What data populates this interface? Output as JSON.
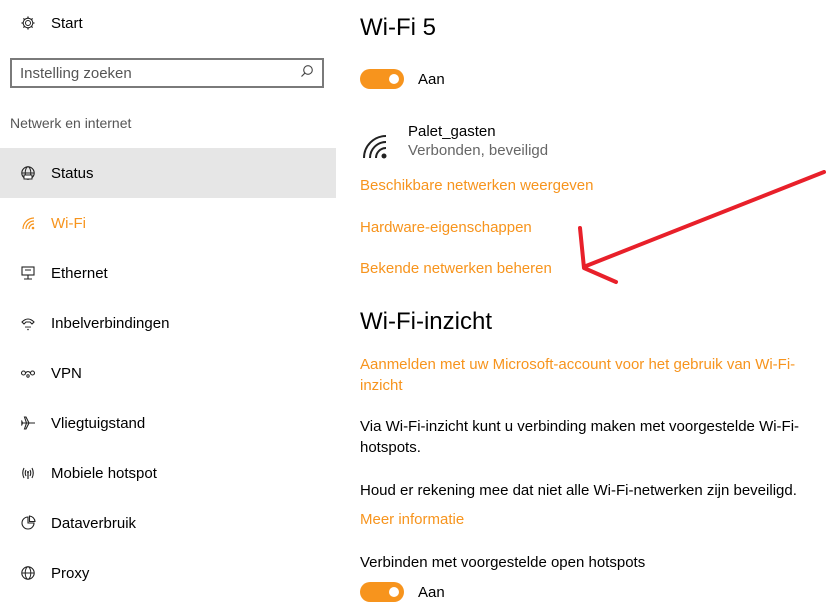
{
  "sidebar": {
    "start_label": "Start",
    "search_placeholder": "Instelling zoeken",
    "section_title": "Netwerk en internet",
    "items": [
      {
        "label": "Status",
        "icon": "globe-icon"
      },
      {
        "label": "Wi-Fi",
        "icon": "wifi-icon"
      },
      {
        "label": "Ethernet",
        "icon": "ethernet-icon"
      },
      {
        "label": "Inbelverbindingen",
        "icon": "dialup-icon"
      },
      {
        "label": "VPN",
        "icon": "vpn-icon"
      },
      {
        "label": "Vliegtuigstand",
        "icon": "airplane-icon"
      },
      {
        "label": "Mobiele hotspot",
        "icon": "hotspot-icon"
      },
      {
        "label": "Dataverbruik",
        "icon": "data-usage-icon"
      },
      {
        "label": "Proxy",
        "icon": "proxy-globe-icon"
      }
    ]
  },
  "main": {
    "title": "Wi-Fi 5",
    "wifi_toggle_label": "Aan",
    "network": {
      "name": "Palet_gasten",
      "status": "Verbonden, beveiligd"
    },
    "links": {
      "show_networks": "Beschikbare netwerken weergeven",
      "hardware": "Hardware-eigenschappen",
      "manage_known": "Bekende netwerken beheren"
    },
    "sense": {
      "title": "Wi-Fi-inzicht",
      "signin_line1": "Aanmelden met uw Microsoft-account voor het gebruik van Wi-Fi-",
      "signin_line2": "inzicht",
      "desc_line1": "Via Wi-Fi-inzicht kunt u verbinding maken met voorgestelde Wi-Fi-",
      "desc_line2": "hotspots.",
      "note": "Houd er rekening mee dat niet alle Wi-Fi-netwerken zijn beveiligd.",
      "more_info": "Meer informatie",
      "hotspot_label": "Verbinden met voorgestelde open hotspots",
      "hotspot_toggle_label": "Aan"
    }
  },
  "colors": {
    "accent": "#f7941d",
    "selected_bg": "#e6e6e6",
    "annotation_arrow": "#e8202a"
  }
}
